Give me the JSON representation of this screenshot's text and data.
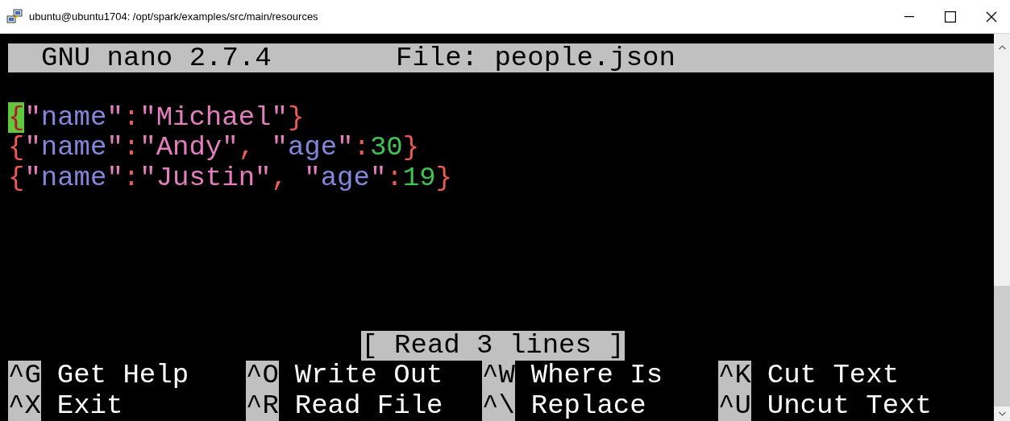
{
  "window": {
    "title": "ubuntu@ubuntu1704: /opt/spark/examples/src/main/resources"
  },
  "nano": {
    "version": "GNU nano 2.7.4",
    "file": "File: people.json"
  },
  "lines": [
    {
      "tokens": [
        {
          "kind": "cursor",
          "text": "{"
        },
        {
          "kind": "string",
          "text": "\""
        },
        {
          "kind": "key",
          "text": "name"
        },
        {
          "kind": "string",
          "text": "\""
        },
        {
          "kind": "punct",
          "text": ":"
        },
        {
          "kind": "string",
          "text": "\"Michael\""
        },
        {
          "kind": "punct",
          "text": "}"
        }
      ]
    },
    {
      "tokens": [
        {
          "kind": "punct",
          "text": "{"
        },
        {
          "kind": "string",
          "text": "\""
        },
        {
          "kind": "key",
          "text": "name"
        },
        {
          "kind": "string",
          "text": "\""
        },
        {
          "kind": "punct",
          "text": ":"
        },
        {
          "kind": "string",
          "text": "\"Andy\""
        },
        {
          "kind": "punct",
          "text": ", "
        },
        {
          "kind": "string",
          "text": "\""
        },
        {
          "kind": "key",
          "text": "age"
        },
        {
          "kind": "string",
          "text": "\""
        },
        {
          "kind": "punct",
          "text": ":"
        },
        {
          "kind": "number",
          "text": "30"
        },
        {
          "kind": "punct",
          "text": "}"
        }
      ]
    },
    {
      "tokens": [
        {
          "kind": "punct",
          "text": "{"
        },
        {
          "kind": "string",
          "text": "\""
        },
        {
          "kind": "key",
          "text": "name"
        },
        {
          "kind": "string",
          "text": "\""
        },
        {
          "kind": "punct",
          "text": ":"
        },
        {
          "kind": "string",
          "text": "\"Justin\""
        },
        {
          "kind": "punct",
          "text": ", "
        },
        {
          "kind": "string",
          "text": "\""
        },
        {
          "kind": "key",
          "text": "age"
        },
        {
          "kind": "string",
          "text": "\""
        },
        {
          "kind": "punct",
          "text": ":"
        },
        {
          "kind": "number",
          "text": "19"
        },
        {
          "kind": "punct",
          "text": "}"
        }
      ]
    }
  ],
  "status": "[ Read 3 lines ]",
  "shortcuts": [
    {
      "key": "^G",
      "label": "Get Help"
    },
    {
      "key": "^O",
      "label": "Write Out"
    },
    {
      "key": "^W",
      "label": "Where Is"
    },
    {
      "key": "^K",
      "label": "Cut Text"
    },
    {
      "key": "^X",
      "label": "Exit"
    },
    {
      "key": "^R",
      "label": "Read File"
    },
    {
      "key": "^\\",
      "label": "Replace"
    },
    {
      "key": "^U",
      "label": "Uncut Text"
    }
  ]
}
